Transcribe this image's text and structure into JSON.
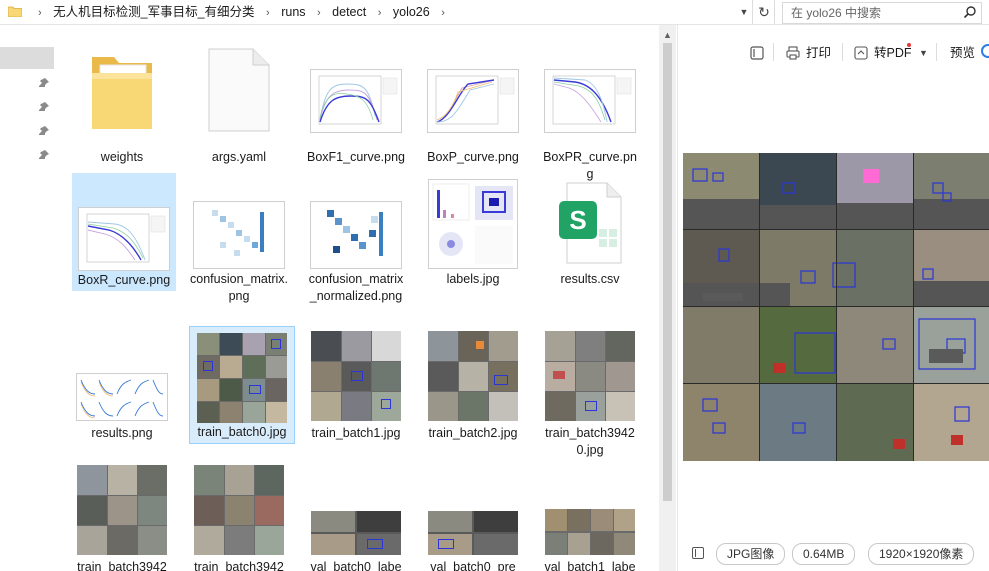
{
  "address_bar": {
    "crumbs": [
      "无人机目标检测_军事目标_有细分类",
      "runs",
      "detect",
      "yolo26"
    ],
    "search_placeholder": "在 yolo26 中搜索"
  },
  "files": [
    {
      "name": "weights",
      "kind": "folder"
    },
    {
      "name": "args.yaml",
      "kind": "blank"
    },
    {
      "name": "BoxF1_curve.png",
      "kind": "curve"
    },
    {
      "name": "BoxP_curve.png",
      "kind": "curve"
    },
    {
      "name": "BoxPR_curve.png",
      "kind": "curve"
    },
    {
      "name": "BoxR_curve.png",
      "kind": "curve"
    },
    {
      "name": "confusion_matrix.png",
      "kind": "matrix"
    },
    {
      "name": "confusion_matrix_normalized.png",
      "kind": "matrix"
    },
    {
      "name": "labels.jpg",
      "kind": "labels"
    },
    {
      "name": "results.csv",
      "kind": "csv"
    },
    {
      "name": "results.png",
      "kind": "results"
    },
    {
      "name": "train_batch0.jpg",
      "kind": "mosaic"
    },
    {
      "name": "train_batch1.jpg",
      "kind": "mosaic"
    },
    {
      "name": "train_batch2.jpg",
      "kind": "mosaic"
    },
    {
      "name": "train_batch39420.jpg",
      "kind": "mosaic"
    },
    {
      "name": "train_batch3942",
      "kind": "mosaic"
    },
    {
      "name": "train_batch3942",
      "kind": "mosaic"
    },
    {
      "name": "val_batch0_labe",
      "kind": "val"
    },
    {
      "name": "val_batch0_pre",
      "kind": "val"
    },
    {
      "name": "val_batch1_labe",
      "kind": "val"
    }
  ],
  "preview": {
    "print_label": "打印",
    "topdf_label": "转PDF",
    "preview_label": "预览",
    "file_type": "JPG图像",
    "file_size": "0.64MB",
    "dimensions": "1920×1920像素"
  },
  "colors": {
    "selection": "#cce8ff",
    "folder": "#f8d775",
    "csv_green": "#21a366",
    "box_blue": "#2a36d8"
  }
}
